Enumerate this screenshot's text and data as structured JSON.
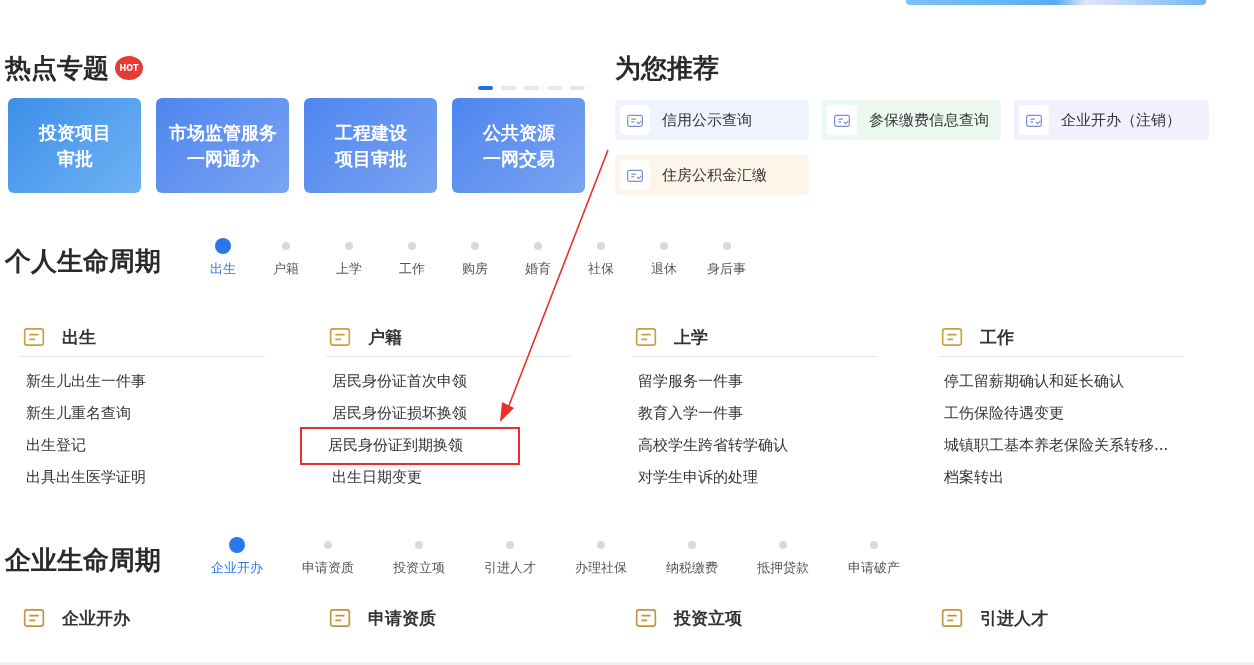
{
  "hot_topics": {
    "title": "热点专题",
    "badge": "HOT",
    "carousel_dots": [
      {
        "selected": true
      },
      {
        "selected": false
      },
      {
        "selected": false
      },
      {
        "selected": false
      },
      {
        "selected": false
      }
    ],
    "cards": [
      {
        "lines": [
          "投资项目",
          "审批"
        ]
      },
      {
        "lines": [
          "市场监管服务",
          "一网通办"
        ]
      },
      {
        "lines": [
          "工程建设",
          "项目审批"
        ]
      },
      {
        "lines": [
          "公共资源",
          "一网交易"
        ]
      }
    ]
  },
  "recommend": {
    "title": "为您推荐",
    "items": [
      {
        "label": "信用公示查询",
        "color": "#eef3fd"
      },
      {
        "label": "参保缴费信息查询",
        "color": "#ecf9f1"
      },
      {
        "label": "企业开办（注销）",
        "color": "#f1f0fd"
      },
      {
        "label": "住房公积金汇缴",
        "color": "#fdf5ea"
      }
    ]
  },
  "personal": {
    "title": "个人生命周期",
    "steps": [
      {
        "label": "出生",
        "selected": true
      },
      {
        "label": "户籍",
        "selected": false
      },
      {
        "label": "上学",
        "selected": false
      },
      {
        "label": "工作",
        "selected": false
      },
      {
        "label": "购房",
        "selected": false
      },
      {
        "label": "婚育",
        "selected": false
      },
      {
        "label": "社保",
        "selected": false
      },
      {
        "label": "退休",
        "selected": false
      },
      {
        "label": "身后事",
        "selected": false
      }
    ],
    "groups": [
      {
        "title": "出生",
        "items": [
          {
            "label": "新生儿出生一件事",
            "highlighted": false
          },
          {
            "label": "新生儿重名查询",
            "highlighted": false
          },
          {
            "label": "出生登记",
            "highlighted": false
          },
          {
            "label": "出具出生医学证明",
            "highlighted": false
          }
        ]
      },
      {
        "title": "户籍",
        "items": [
          {
            "label": "居民身份证首次申领",
            "highlighted": false
          },
          {
            "label": "居民身份证损坏换领",
            "highlighted": false
          },
          {
            "label": "居民身份证到期换领",
            "highlighted": true
          },
          {
            "label": "出生日期变更",
            "highlighted": false
          }
        ]
      },
      {
        "title": "上学",
        "items": [
          {
            "label": "留学服务一件事",
            "highlighted": false
          },
          {
            "label": "教育入学一件事",
            "highlighted": false
          },
          {
            "label": "高校学生跨省转学确认",
            "highlighted": false
          },
          {
            "label": "对学生申诉的处理",
            "highlighted": false
          }
        ]
      },
      {
        "title": "工作",
        "items": [
          {
            "label": "停工留薪期确认和延长确认",
            "highlighted": false
          },
          {
            "label": "工伤保险待遇变更",
            "highlighted": false
          },
          {
            "label": "城镇职工基本养老保险关系转移...",
            "highlighted": false
          },
          {
            "label": "档案转出",
            "highlighted": false
          }
        ]
      }
    ]
  },
  "enterprise": {
    "title": "企业生命周期",
    "steps": [
      {
        "label": "企业开办",
        "selected": true
      },
      {
        "label": "申请资质",
        "selected": false
      },
      {
        "label": "投资立项",
        "selected": false
      },
      {
        "label": "引进人才",
        "selected": false
      },
      {
        "label": "办理社保",
        "selected": false
      },
      {
        "label": "纳税缴费",
        "selected": false
      },
      {
        "label": "抵押贷款",
        "selected": false
      },
      {
        "label": "申请破产",
        "selected": false
      }
    ],
    "groups": [
      {
        "title": "企业开办"
      },
      {
        "title": "申请资质"
      },
      {
        "title": "投资立项"
      },
      {
        "title": "引进人才"
      }
    ]
  }
}
